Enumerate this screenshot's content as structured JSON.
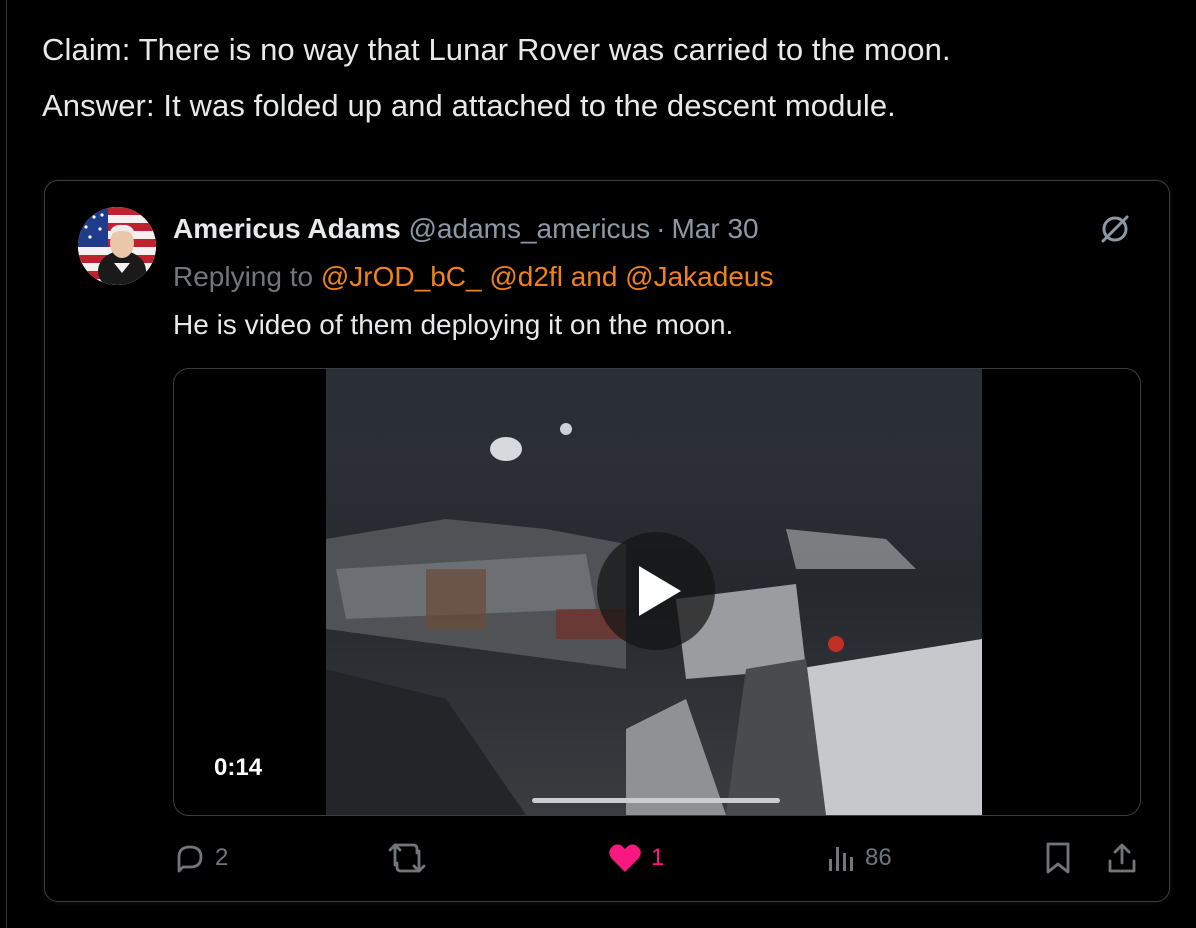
{
  "post": {
    "line1": "Claim: There is no way that Lunar Rover was carried to the moon.",
    "line2": "Answer: It was folded up and attached to the descent module."
  },
  "quote": {
    "author_name": "Americus Adams",
    "author_handle": "@adams_americus",
    "separator": "·",
    "date": "Mar 30",
    "replying_prefix": "Replying to",
    "mentions": "@JrOD_bC_ @d2fl and @Jakadeus",
    "body": "He is video of them deploying it on the moon.",
    "video": {
      "duration": "0:14",
      "play_icon": "play-icon"
    },
    "stats": {
      "replies": "2",
      "reposts": "",
      "likes": "1",
      "views": "86"
    }
  },
  "colors": {
    "background": "#000000",
    "text": "#e7e9ea",
    "muted": "#71767b",
    "mention": "#f0821e",
    "like": "#f91880"
  },
  "icons": [
    "mute-icon",
    "reply-icon",
    "repost-icon",
    "heart-icon",
    "views-icon",
    "bookmark-icon",
    "share-icon"
  ]
}
